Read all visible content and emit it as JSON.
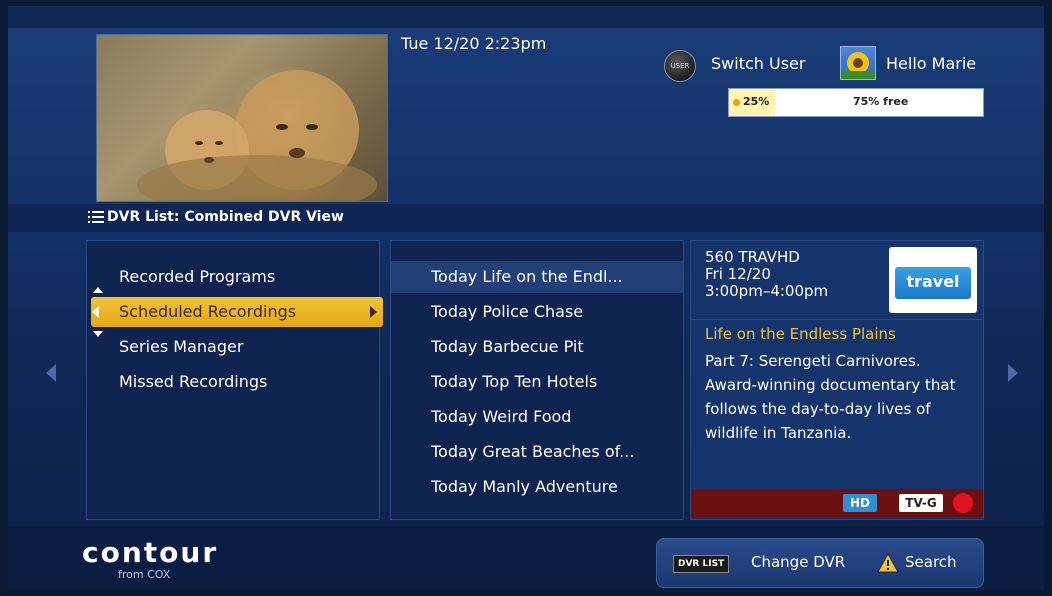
{
  "header": {
    "datetime": "Tue 12/20  2:23pm",
    "user_icon_label": "USER",
    "switch_user_label": "Switch User",
    "greeting": "Hello Marie",
    "storage": {
      "used_fraction": 0.25,
      "used_label": "25%",
      "free_label": "75% free",
      "used_color": "#fff4b0",
      "dot_color": "#f39c12"
    }
  },
  "dvr_bar": {
    "icon": "list-icon",
    "title": "DVR List: Combined DVR View"
  },
  "menu": {
    "items": [
      {
        "label": "Recorded Programs"
      },
      {
        "label": "Scheduled Recordings"
      },
      {
        "label": "Series Manager"
      },
      {
        "label": "Missed Recordings"
      }
    ],
    "selected_index": 1,
    "selected_color": "#f4c23a"
  },
  "recordings": [
    "Today Life on the Endl...",
    "Today Police Chase",
    "Today Barbecue Pit",
    "Today Top Ten Hotels",
    "Today Weird Food",
    "Today Great Beaches of...",
    "Today Manly Adventure"
  ],
  "detail": {
    "channel": "560 TRAVHD",
    "date": "Fri 12/20",
    "time": "3:00pm–4:00pm",
    "network_logo_text": "travel",
    "title": "Life on the Endless Plains",
    "description": "Part 7: Serengeti Carnivores. Award-winning documentary that follows the day-to-day lives of wildlife in Tanzania.",
    "hd_label": "HD",
    "rating_label": "TV-G",
    "accent_color": "#f4c23a",
    "record_indicator_color": "#e0121f"
  },
  "footer": {
    "logo_main": "contour",
    "logo_sub": "from COX",
    "dvr_key_label": "DVR LIST",
    "change_dvr_label": "Change DVR",
    "search_icon": "warning-triangle-icon",
    "search_label": "Search"
  }
}
